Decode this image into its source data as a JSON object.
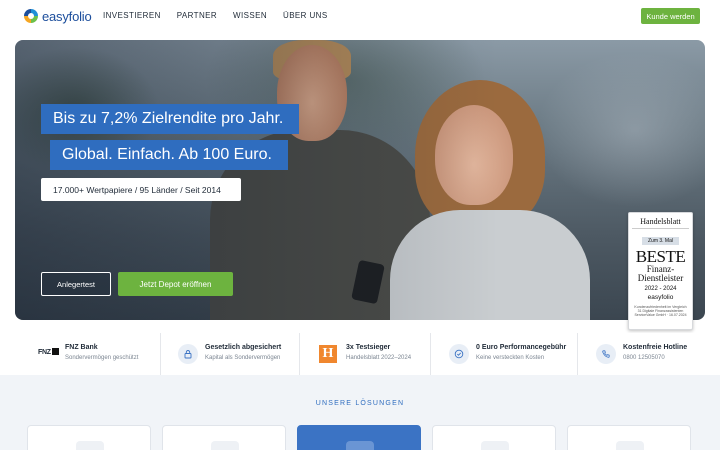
{
  "header": {
    "logo_text": "easyfolio",
    "nav": [
      "INVESTIEREN",
      "PARTNER",
      "WISSEN",
      "ÜBER UNS"
    ],
    "cta": "Kunde werden"
  },
  "hero": {
    "headline1": "Bis zu 7,2% Zielrendite pro Jahr.",
    "headline2": "Global. Einfach. Ab 100 Euro.",
    "subline": "17.000+ Wertpapiere / 95 Länder / Seit 2014",
    "btn_secondary": "Anlegertest",
    "btn_primary": "Jetzt Depot eröffnen"
  },
  "badge": {
    "publication": "Handelsblatt",
    "date": "Zum 3. Mal",
    "title": "BESTE",
    "subtitle1": "Finanz-",
    "subtitle2": "Dienstleister",
    "years": "2022 - 2024",
    "brand": "easyfolio",
    "smallprint": "Kundenzufriedenheit im Vergleich 31 Digitale Finanzassistenten ServiceValue GmbH · 16.07.2024"
  },
  "trust": [
    {
      "title": "FNZ Bank",
      "sub": "Sondervermögen geschützt",
      "logo": "FNZ"
    },
    {
      "title": "Gesetzlich abgesichert",
      "sub": "Kapital als Sondervermögen",
      "icon": "lock-icon"
    },
    {
      "title": "3x Testsieger",
      "sub": "Handelsblatt 2022–2024",
      "logo": "H"
    },
    {
      "title": "0 Euro Performancegebühr",
      "sub": "Keine versteckten Kosten",
      "icon": "check-circle-icon"
    },
    {
      "title": "Kostenfreie Hotline",
      "sub": "0800 12505070",
      "icon": "phone-icon"
    }
  ],
  "solutions": {
    "label": "UNSERE LÖSUNGEN"
  },
  "colors": {
    "brand_blue": "#2f6dbf",
    "brand_green": "#6db33f",
    "logo_blue": "#1c4e9c"
  }
}
